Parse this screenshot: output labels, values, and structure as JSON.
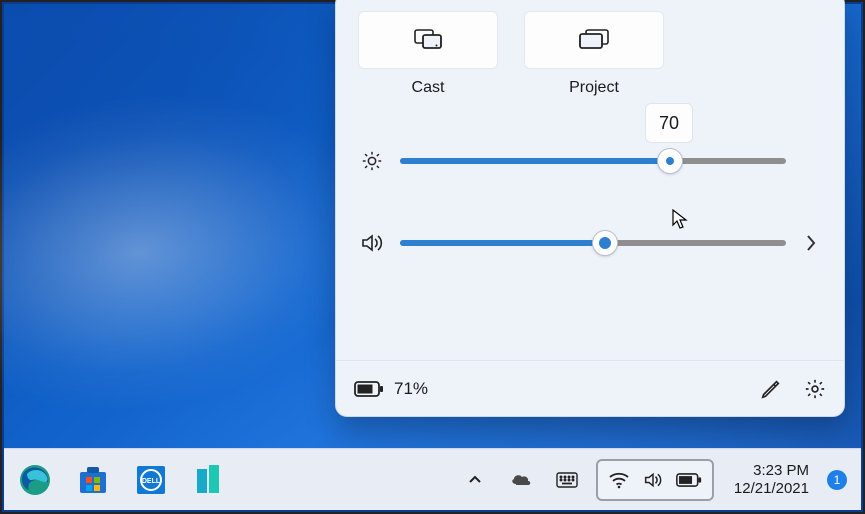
{
  "panel": {
    "tiles": {
      "cast": {
        "label": "Cast"
      },
      "project": {
        "label": "Project"
      }
    },
    "brightness": {
      "percent": 70,
      "tooltip_value": "70"
    },
    "volume": {
      "percent": 53
    },
    "footer": {
      "battery_text": "71%"
    }
  },
  "taskbar": {
    "clock": {
      "time": "3:23 PM",
      "date": "12/21/2021"
    },
    "notifications": {
      "count": "1"
    }
  }
}
